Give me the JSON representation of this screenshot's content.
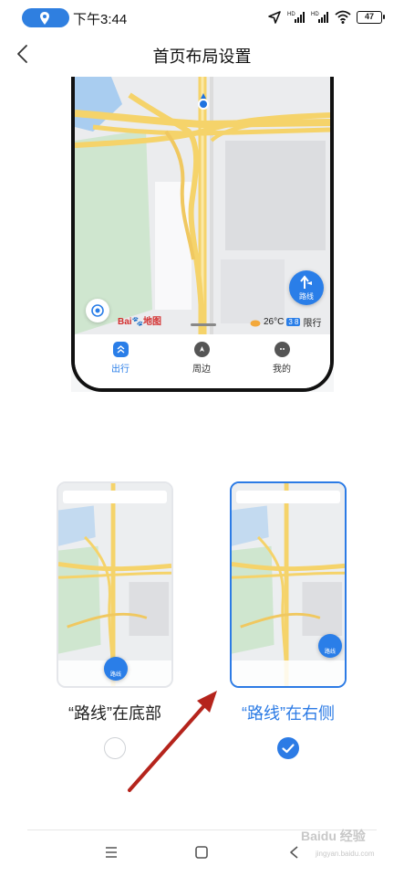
{
  "status_bar": {
    "time": "下午3:44",
    "battery": "47",
    "signal_labels": [
      "HD",
      "HD"
    ]
  },
  "header": {
    "title": "首页布局设置",
    "back_icon": "chevron-left-icon"
  },
  "preview": {
    "tabs": [
      {
        "label": "出行",
        "icon": "travel-icon",
        "active": true
      },
      {
        "label": "周边",
        "icon": "nearby-icon",
        "active": false
      },
      {
        "label": "我的",
        "icon": "profile-icon",
        "active": false
      }
    ],
    "route_button": "路线",
    "logo_text": "Bai",
    "logo_suffix": "地图",
    "temperature": "26°C",
    "limit_numbers": "3 8",
    "limit_text": "限行"
  },
  "options": [
    {
      "label": "“路线”在底部",
      "selected": false,
      "mini_route_label": "路线"
    },
    {
      "label": "“路线”在右侧",
      "selected": true,
      "mini_route_label": "路线"
    }
  ],
  "navbar": {
    "icons": [
      "menu-icon",
      "home-square-icon",
      "back-triangle-icon"
    ]
  },
  "watermark": {
    "main": "Baidu 经验",
    "sub": "jingyan.baidu.com"
  },
  "colors": {
    "accent": "#2c7be5",
    "arrow": "#b5241c",
    "road_yellow": "#f5d36a",
    "green_area": "#cfe6cf",
    "water": "#a9cdf0"
  }
}
